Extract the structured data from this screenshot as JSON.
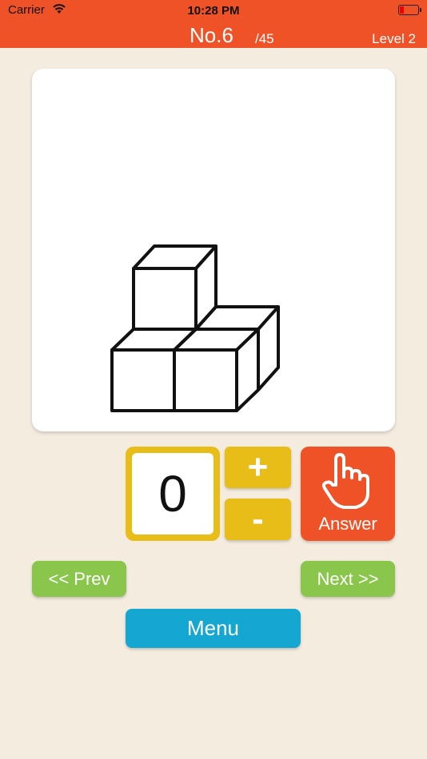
{
  "status_bar": {
    "carrier": "Carrier",
    "time": "10:28 PM"
  },
  "header": {
    "puzzle_number": "No.6",
    "puzzle_total": "/45",
    "level": "Level 2"
  },
  "counter": {
    "value": "0",
    "increment_label": "+",
    "decrement_label": "-"
  },
  "answer_button": {
    "label": "Answer",
    "icon": "pointing-hand-icon"
  },
  "navigation": {
    "prev_label": "<< Prev",
    "next_label": "Next >>",
    "menu_label": "Menu"
  },
  "colors": {
    "header": "#ef5227",
    "background": "#f5ece0",
    "counter": "#e8bd17",
    "answer": "#ef5227",
    "nav": "#8ac64b",
    "menu": "#14a7d2"
  }
}
